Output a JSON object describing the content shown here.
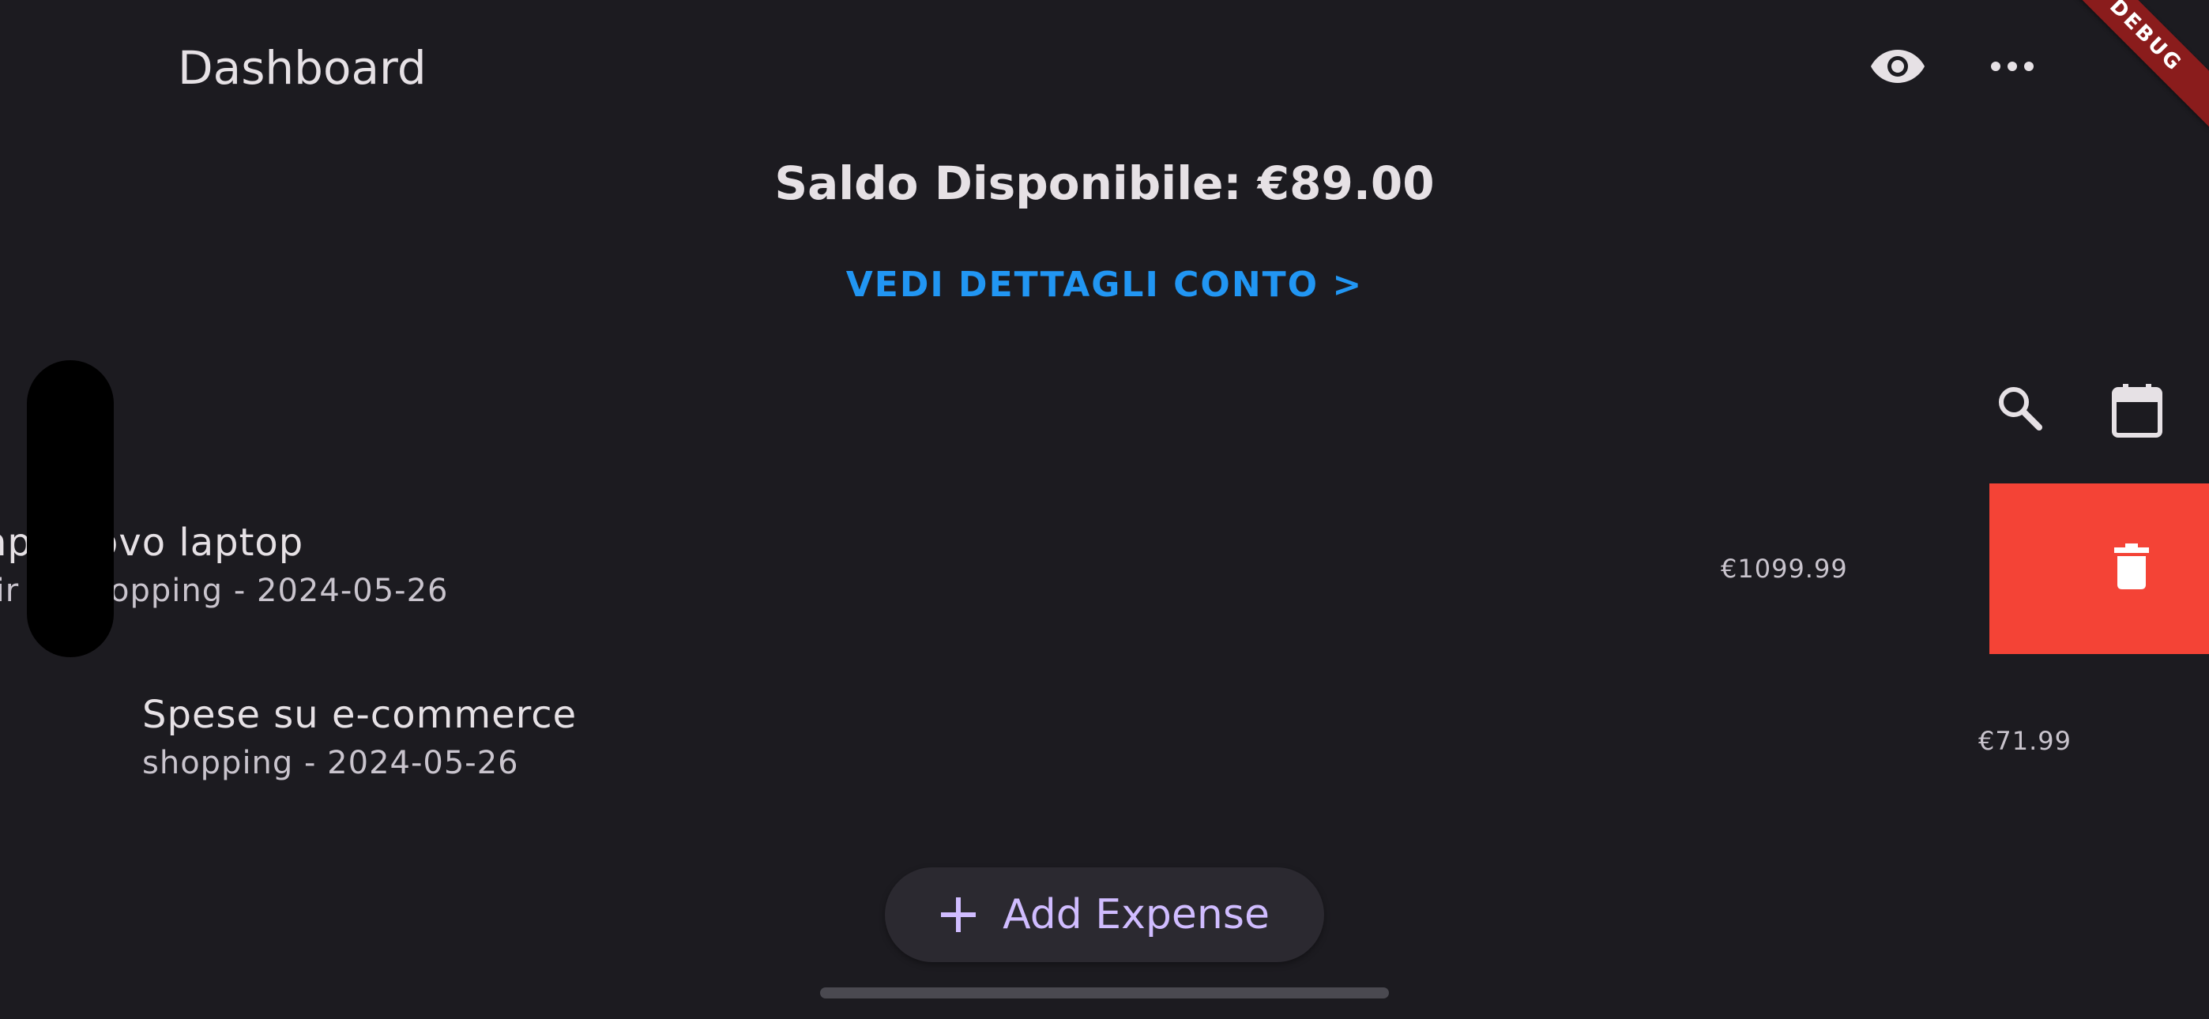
{
  "app_bar": {
    "title": "Dashboard",
    "actions": [
      {
        "icon": "eye-icon"
      },
      {
        "icon": "more-horizontal-icon"
      }
    ]
  },
  "debug_banner": "DEBUG",
  "balance": {
    "text": "Saldo Disponibile: €89.00"
  },
  "details_link": {
    "label": "VEDI DETTAGLI CONTO >"
  },
  "toolbar": {
    "actions": [
      {
        "icon": "search-icon"
      },
      {
        "icon": "calendar-icon"
      }
    ]
  },
  "expenses": [
    {
      "title": "np   nuovo laptop",
      "subtitle": "tir   o, shopping - 2024-05-26",
      "amount": "€1099.99",
      "swipe_action": {
        "icon": "trash-icon"
      }
    },
    {
      "title": "Spese su e-commerce",
      "subtitle": "shopping - 2024-05-26",
      "amount": "€71.99"
    }
  ],
  "fab": {
    "label": "Add Expense",
    "icon": "plus-icon"
  },
  "colors": {
    "background": "#1c1b20",
    "link": "#2196f3",
    "delete": "#f44336",
    "fab_bg": "#2b2930",
    "fab_text": "#d0bcff",
    "debug": "#8a1c1c"
  }
}
